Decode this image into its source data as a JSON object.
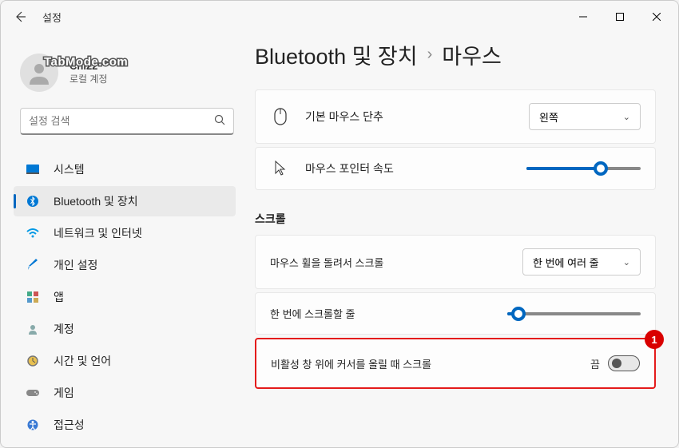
{
  "window": {
    "title": "설정"
  },
  "user": {
    "name": "Chi22",
    "type": "로컬 계정"
  },
  "watermark": "TabMode.com",
  "search": {
    "placeholder": "설정 검색"
  },
  "nav": {
    "items": [
      {
        "label": "시스템"
      },
      {
        "label": "Bluetooth 및 장치"
      },
      {
        "label": "네트워크 및 인터넷"
      },
      {
        "label": "개인 설정"
      },
      {
        "label": "앱"
      },
      {
        "label": "계정"
      },
      {
        "label": "시간 및 언어"
      },
      {
        "label": "게임"
      },
      {
        "label": "접근성"
      }
    ],
    "activeIndex": 1
  },
  "breadcrumb": {
    "parent": "Bluetooth 및 장치",
    "current": "마우스"
  },
  "settings": {
    "primaryButton": {
      "label": "기본 마우스 단추",
      "value": "왼쪽"
    },
    "pointerSpeed": {
      "label": "마우스 포인터 속도",
      "percent": 65
    },
    "scrollSection": "스크롤",
    "wheelScroll": {
      "label": "마우스 휠을 돌려서 스크롤",
      "value": "한 번에 여러 줄"
    },
    "linesAtTime": {
      "label": "한 번에 스크롤할 줄",
      "percent": 8
    },
    "hoverScroll": {
      "label": "비활성 창 위에 커서를 올릴 때 스크롤",
      "state": "끔"
    }
  },
  "annotation": {
    "number": "1"
  }
}
